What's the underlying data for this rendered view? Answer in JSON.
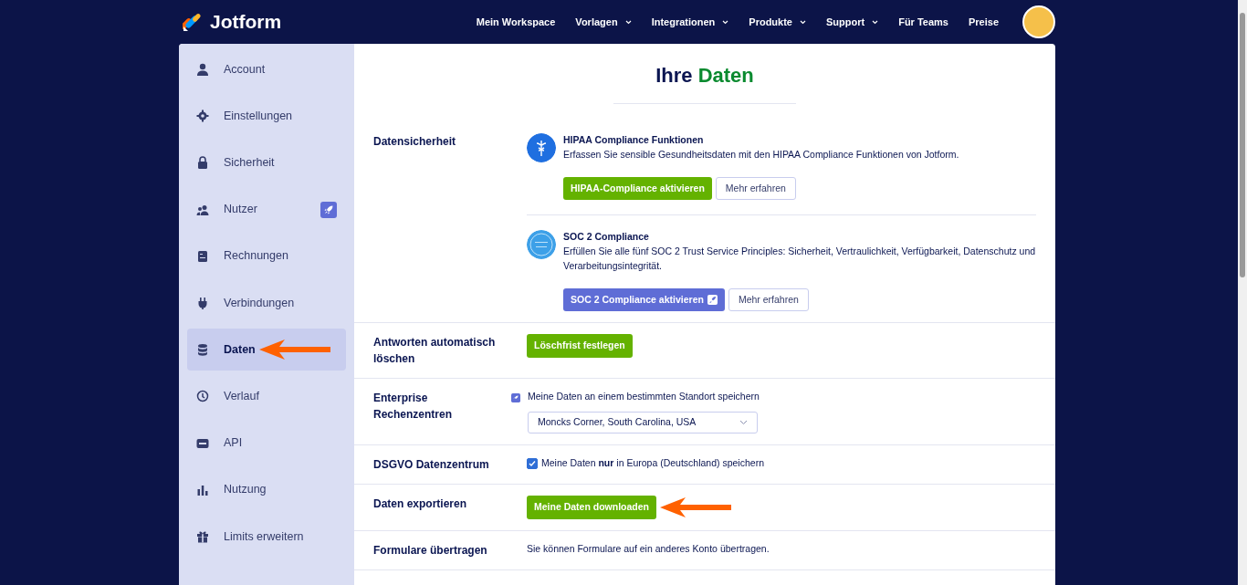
{
  "brand": {
    "name": "Jotform"
  },
  "nav": [
    {
      "label": "Mein Workspace",
      "dropdown": false
    },
    {
      "label": "Vorlagen",
      "dropdown": true
    },
    {
      "label": "Integrationen",
      "dropdown": true
    },
    {
      "label": "Produkte",
      "dropdown": true
    },
    {
      "label": "Support",
      "dropdown": true
    },
    {
      "label": "Für Teams",
      "dropdown": false
    },
    {
      "label": "Preise",
      "dropdown": false
    }
  ],
  "sidebar": {
    "items": [
      {
        "label": "Account",
        "selected": false,
        "rocket": false,
        "annotated": false
      },
      {
        "label": "Einstellungen",
        "selected": false,
        "rocket": false,
        "annotated": false
      },
      {
        "label": "Sicherheit",
        "selected": false,
        "rocket": false,
        "annotated": false
      },
      {
        "label": "Nutzer",
        "selected": false,
        "rocket": true,
        "annotated": false
      },
      {
        "label": "Rechnungen",
        "selected": false,
        "rocket": false,
        "annotated": false
      },
      {
        "label": "Verbindungen",
        "selected": false,
        "rocket": false,
        "annotated": false
      },
      {
        "label": "Daten",
        "selected": true,
        "rocket": false,
        "annotated": true
      },
      {
        "label": "Verlauf",
        "selected": false,
        "rocket": false,
        "annotated": false
      },
      {
        "label": "API",
        "selected": false,
        "rocket": false,
        "annotated": false
      },
      {
        "label": "Nutzung",
        "selected": false,
        "rocket": false,
        "annotated": false
      },
      {
        "label": "Limits erweitern",
        "selected": false,
        "rocket": false,
        "annotated": false
      }
    ]
  },
  "title": "Ihre",
  "title_highlight": "Daten",
  "rows": [
    {
      "kind": "features",
      "label": "Datensicherheit",
      "features": [
        {
          "title": "HIPAA Compliance Funktionen",
          "description": "Erfassen Sie sensible Gesundheitsdaten mit den HIPAA Compliance Funktionen von Jotform.",
          "primary": {
            "label": "HIPAA-Compliance aktivieren",
            "rocket": false
          },
          "secondary": "Mehr erfahren"
        },
        {
          "title": "SOC 2 Compliance",
          "description": "Erfüllen Sie alle fünf SOC 2 Trust Service Principles: Sicherheit, Vertraulichkeit, Verfügbarkeit, Datenschutz und Verarbeitungsintegrität.",
          "primary": {
            "label": "SOC 2 Compliance aktivieren",
            "rocket": true
          },
          "secondary": "Mehr erfahren"
        }
      ]
    },
    {
      "kind": "button",
      "label": "Antworten automatisch löschen",
      "button": "Löschfrist festlegen",
      "annotated": false
    },
    {
      "kind": "select",
      "label": "Enterprise Rechenzentren",
      "rocket": true,
      "text": "Meine Daten an einem bestimmten Standort speichern",
      "value": "Moncks Corner, South Carolina, USA"
    },
    {
      "kind": "checkbox",
      "label": "DSGVO Datenzentrum",
      "checked": true,
      "text": "Meine Daten **nur** in Europa (Deutschland) speichern"
    },
    {
      "kind": "button",
      "label": "Daten exportieren",
      "button": "Meine Daten downloaden",
      "annotated": true
    },
    {
      "kind": "text",
      "label": "Formulare übertragen",
      "text": "Sie können Formulare auf ein anderes Konto übertragen."
    }
  ]
}
